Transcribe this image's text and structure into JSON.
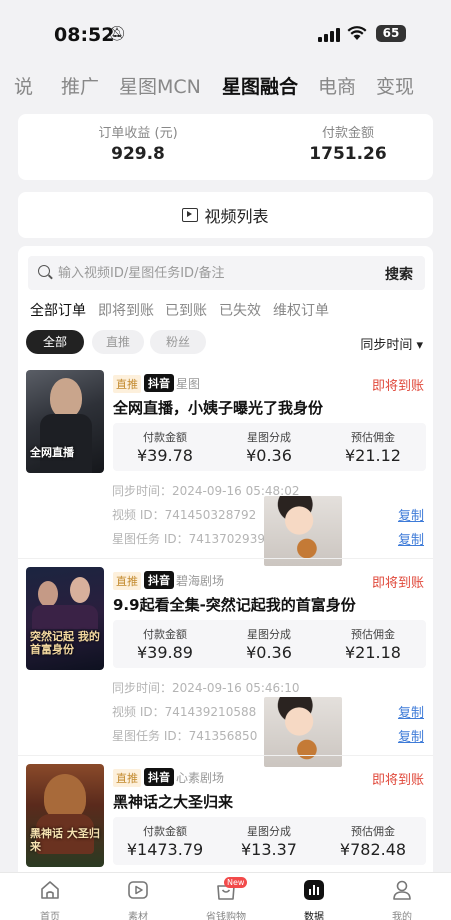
{
  "status_bar": {
    "time": "08:52",
    "battery": "65"
  },
  "tabs": [
    "说",
    "推广",
    "星图MCN",
    "星图融合",
    "电商",
    "变现"
  ],
  "active_tab": "星图融合",
  "summary": {
    "order_income_label": "订单收益 (元)",
    "order_income_value": "929.8",
    "paid_amount_label": "付款金额",
    "paid_amount_value": "1751.26"
  },
  "video_list": {
    "title": "视频列表"
  },
  "search": {
    "placeholder": "输入视频ID/星图任务ID/备注",
    "button": "搜索"
  },
  "order_tabs": [
    "全部订单",
    "即将到账",
    "已到账",
    "已失效",
    "维权订单"
  ],
  "filters": [
    "全部",
    "直推",
    "粉丝"
  ],
  "sort": {
    "label": "同步时间",
    "arrow": "▾"
  },
  "metric_labels": {
    "paid": "付款金额",
    "share": "星图分成",
    "commission": "预估佣金"
  },
  "meta_labels": {
    "sync": "同步时间：",
    "video_id": "视频 ID：",
    "task_id": "星图任务 ID："
  },
  "copy_label": "复制",
  "tag_labels": {
    "zhitui": "直推",
    "douyin": "抖音"
  },
  "orders": [
    {
      "source": "星图",
      "status": "即将到账",
      "title": "全网直播，小姨子曝光了我身份",
      "thumb_text": "全网直播",
      "paid": "¥39.78",
      "share": "¥0.36",
      "commission": "¥21.12",
      "sync_time": "2024-09-16 05:48:02",
      "video_id": "741450328792",
      "task_id": "7413702939"
    },
    {
      "source": "碧海剧场",
      "status": "即将到账",
      "title": "9.9起看全集-突然记起我的首富身份",
      "thumb_text": "突然记起 我的首富身份",
      "paid": "¥39.89",
      "share": "¥0.36",
      "commission": "¥21.18",
      "sync_time": "2024-09-16 05:46:10",
      "video_id": "741439210588",
      "task_id": "741356850"
    },
    {
      "source": "心素剧场",
      "status": "即将到账",
      "title": "黑神话之大圣归来",
      "thumb_text": "黑神话 大圣归来",
      "paid": "¥1473.79",
      "share": "¥13.37",
      "commission": "¥782.48"
    }
  ],
  "bottom_nav": [
    {
      "label": "首页",
      "icon": "home-icon"
    },
    {
      "label": "素材",
      "icon": "play-square-icon"
    },
    {
      "label": "省钱购物",
      "icon": "shopping-bag-icon",
      "badge": "New"
    },
    {
      "label": "数据",
      "icon": "data-chart-icon",
      "active": true
    },
    {
      "label": "我的",
      "icon": "person-icon"
    }
  ]
}
